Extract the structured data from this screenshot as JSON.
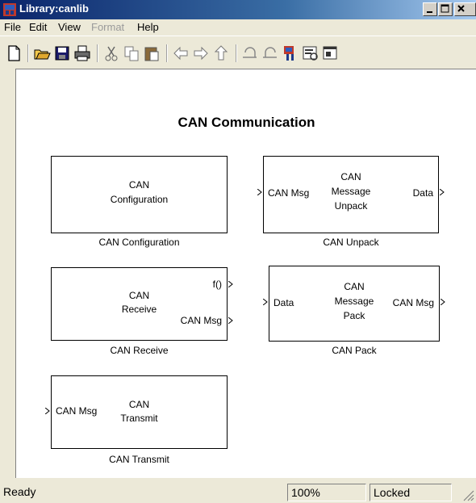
{
  "window": {
    "title": "Library:canlib"
  },
  "menu": [
    "File",
    "Edit",
    "View",
    "Format",
    "Help"
  ],
  "toolbar_icons": [
    "new-icon",
    "open-icon",
    "save-icon",
    "print-icon",
    "cut-icon",
    "copy-icon",
    "paste-icon",
    "back-icon",
    "forward-icon",
    "up-icon",
    "undo-icon",
    "redo-icon",
    "library-browser-icon",
    "model-explorer-icon",
    "debugger-icon"
  ],
  "canvas": {
    "title": "CAN Communication",
    "blocks": {
      "config": {
        "lines": [
          "CAN",
          "Configuration"
        ],
        "caption": "CAN Configuration"
      },
      "unpack": {
        "lines": [
          "CAN",
          "Message",
          "Unpack"
        ],
        "in": "CAN Msg",
        "out": "Data",
        "caption": "CAN Unpack"
      },
      "receive": {
        "lines": [
          "CAN",
          "Receive"
        ],
        "out1": "f()",
        "out2": "CAN Msg",
        "caption": "CAN Receive"
      },
      "pack": {
        "lines": [
          "CAN",
          "Message",
          "Pack"
        ],
        "in": "Data",
        "out": "CAN Msg",
        "caption": "CAN Pack"
      },
      "transmit": {
        "lines": [
          "CAN",
          "Transmit"
        ],
        "in": "CAN Msg",
        "caption": "CAN Transmit"
      }
    }
  },
  "status": {
    "state": "Ready",
    "zoom": "100%",
    "lock": "Locked"
  }
}
